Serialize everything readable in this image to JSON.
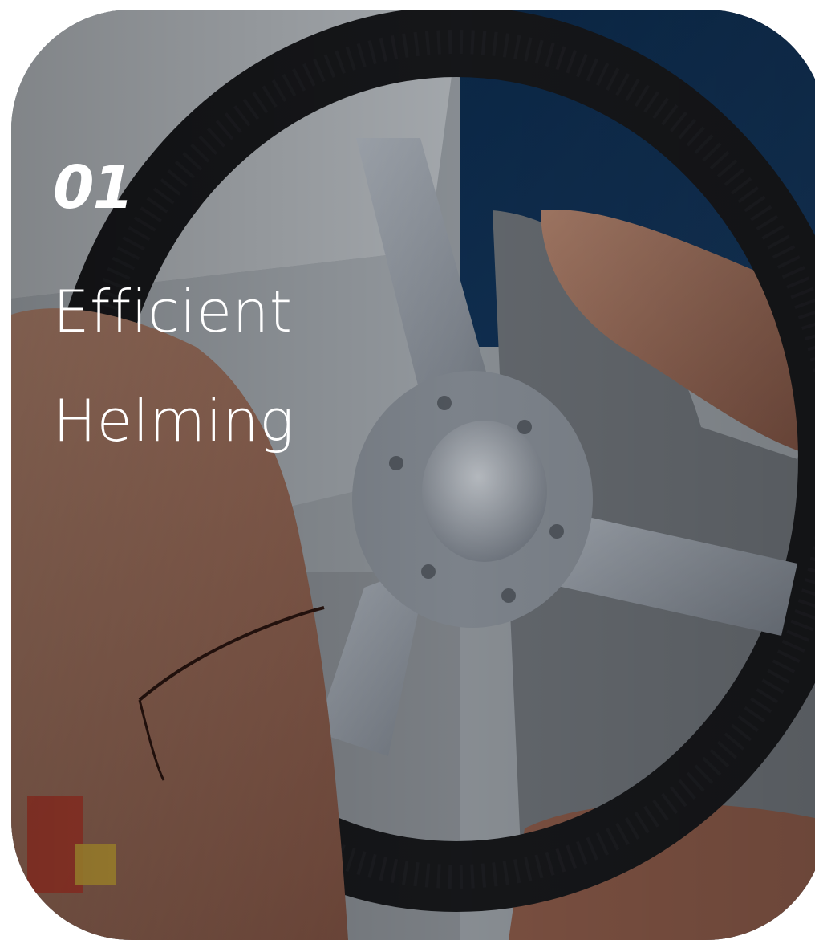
{
  "card": {
    "number": "01",
    "title_line1": "Efficient",
    "title_line2": "Helming",
    "image": "boat-steering-wheel-photo"
  },
  "colors": {
    "text": "#ffffff",
    "wheel": "#1b1c1f",
    "water": "#0f2f55"
  }
}
